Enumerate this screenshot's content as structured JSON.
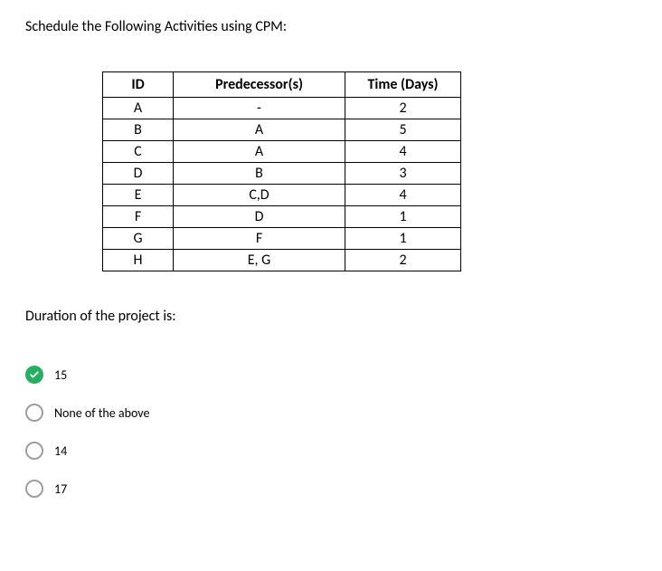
{
  "question": {
    "title": "Schedule the Following Activities using CPM:",
    "sub_question": "Duration of the project is:"
  },
  "table": {
    "headers": {
      "id": "ID",
      "predecessor": "Predecessor(s)",
      "time": "Time (Days)"
    },
    "rows": [
      {
        "id": "A",
        "predecessor": "-",
        "time": "2"
      },
      {
        "id": "B",
        "predecessor": "A",
        "time": "5"
      },
      {
        "id": "C",
        "predecessor": "A",
        "time": "4"
      },
      {
        "id": "D",
        "predecessor": "B",
        "time": "3"
      },
      {
        "id": "E",
        "predecessor": "C,D",
        "time": "4"
      },
      {
        "id": "F",
        "predecessor": "D",
        "time": "1"
      },
      {
        "id": "G",
        "predecessor": "F",
        "time": "1"
      },
      {
        "id": "H",
        "predecessor": "E, G",
        "time": "2"
      }
    ]
  },
  "options": [
    {
      "label": "15",
      "selected": true
    },
    {
      "label": "None of the above",
      "selected": false
    },
    {
      "label": "14",
      "selected": false
    },
    {
      "label": "17",
      "selected": false
    }
  ]
}
